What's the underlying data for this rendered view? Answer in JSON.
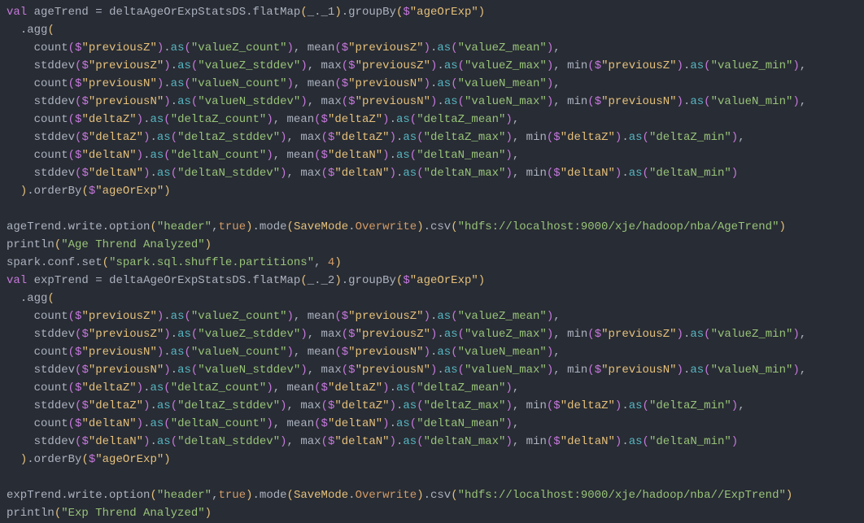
{
  "code": {
    "var1": "ageTrend",
    "var2": "expTrend",
    "source": "deltaAgeOrExpStatsDS",
    "flatMap1": "_._1",
    "flatMap2": "_._2",
    "groupByCol": "\"ageOrExp\"",
    "orderByCol": "\"ageOrExp\"",
    "prevZ": "\"previousZ\"",
    "prevN": "\"previousN\"",
    "deltaZ": "\"deltaZ\"",
    "deltaN": "\"deltaN\"",
    "valueZ_count": "\"valueZ_count\"",
    "valueZ_mean": "\"valueZ_mean\"",
    "valueZ_stddev": "\"valueZ_stddev\"",
    "valueZ_max": "\"valueZ_max\"",
    "valueZ_min": "\"valueZ_min\"",
    "valueN_count": "\"valueN_count\"",
    "valueN_mean": "\"valueN_mean\"",
    "valueN_stddev": "\"valueN_stddev\"",
    "valueN_max": "\"valueN_max\"",
    "valueN_min": "\"valueN_min\"",
    "deltaZ_count": "\"deltaZ_count\"",
    "deltaZ_mean": "\"deltaZ_mean\"",
    "deltaZ_stddev": "\"deltaZ_stddev\"",
    "deltaZ_max": "\"deltaZ_max\"",
    "deltaZ_min": "\"deltaZ_min\"",
    "deltaN_count": "\"deltaN_count\"",
    "deltaN_mean": "\"deltaN_mean\"",
    "deltaN_stddev": "\"deltaN_stddev\"",
    "deltaN_max": "\"deltaN_max\"",
    "deltaN_min": "\"deltaN_min\"",
    "headerKey": "\"header\"",
    "trueLit": "true",
    "saveModeObj": "SaveMode",
    "overwriteConst": "Overwrite",
    "hdfsAge": "\"hdfs://localhost:9000/xje/hadoop/nba/AgeTrend\"",
    "hdfsExp": "\"hdfs://localhost:9000/xje/hadoop/nba//ExpTrend\"",
    "printlnAge": "\"Age Thrend Analyzed\"",
    "printlnExp": "\"Exp Thrend Analyzed\"",
    "sparkConfKey": "\"spark.sql.shuffle.partitions\"",
    "sparkConfVal": "4"
  }
}
